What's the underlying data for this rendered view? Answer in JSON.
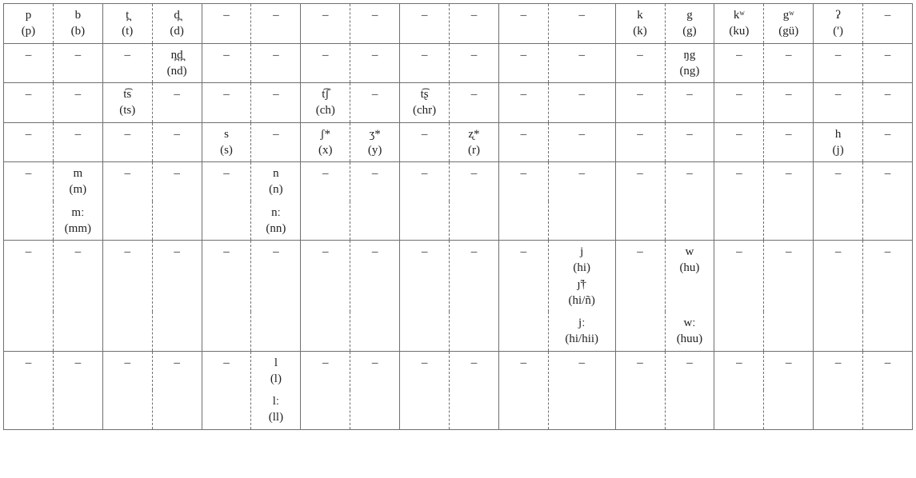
{
  "dash": "–",
  "rows": [
    {
      "cells": [
        {
          "ipa": "p",
          "orth": "(p)"
        },
        {
          "ipa": "b",
          "orth": "(b)"
        },
        {
          "ipa": "t̪",
          "orth": "(t)"
        },
        {
          "ipa": "d̪",
          "orth": "(d)"
        },
        null,
        null,
        null,
        null,
        null,
        null,
        null,
        null,
        {
          "ipa": "k",
          "orth": "(k)"
        },
        {
          "ipa": "g",
          "orth": "(g)"
        },
        {
          "ipa": "kʷ",
          "orth": "(ku)"
        },
        {
          "ipa": "gʷ",
          "orth": "(gü)"
        },
        {
          "ipa": "ʔ",
          "orth": "(')"
        },
        null
      ]
    },
    {
      "cells": [
        null,
        null,
        null,
        {
          "ipa": "n̪d̪",
          "orth": "(nd)"
        },
        null,
        null,
        null,
        null,
        null,
        null,
        null,
        null,
        null,
        {
          "ipa": "ŋg",
          "orth": "(ng)"
        },
        null,
        null,
        null,
        null
      ]
    },
    {
      "cells": [
        null,
        null,
        {
          "ipa": "t͡s",
          "orth": "(ts)"
        },
        null,
        null,
        null,
        {
          "ipa": "t͡ʃ",
          "orth": "(ch)"
        },
        null,
        {
          "ipa": "t͡ʂ",
          "orth": "(chr)"
        },
        null,
        null,
        null,
        null,
        null,
        null,
        null,
        null,
        null
      ]
    },
    {
      "cells": [
        null,
        null,
        null,
        null,
        {
          "ipa": "s",
          "orth": "(s)"
        },
        null,
        {
          "ipa": "ʃ*",
          "orth": "(x)"
        },
        {
          "ipa": "ʒ*",
          "orth": "(y)"
        },
        null,
        {
          "ipa": "ʐ*",
          "orth": "(r)"
        },
        null,
        null,
        null,
        null,
        null,
        null,
        {
          "ipa": "h",
          "orth": "(j)"
        },
        null
      ]
    },
    {
      "cells": [
        null,
        {
          "ipa": "m",
          "orth": "(m)"
        },
        null,
        null,
        null,
        {
          "ipa": "n",
          "orth": "(n)"
        },
        null,
        null,
        null,
        null,
        null,
        null,
        null,
        null,
        null,
        null,
        null,
        null
      ]
    },
    {
      "cells": [
        "",
        {
          "ipa": "mː",
          "orth": "(mm)"
        },
        "",
        "",
        "",
        {
          "ipa": "nː",
          "orth": "(nn)"
        },
        "",
        "",
        "",
        "",
        "",
        "",
        "",
        "",
        "",
        "",
        "",
        ""
      ]
    },
    {
      "cells": [
        null,
        null,
        null,
        null,
        null,
        null,
        null,
        null,
        null,
        null,
        null,
        {
          "ipa": "j",
          "orth": "(hi)",
          "ipa2": "ȷ̃†",
          "orth2": "(hi/ñ)"
        },
        null,
        {
          "ipa": "w",
          "orth": "(hu)"
        },
        null,
        null,
        null,
        null
      ]
    },
    {
      "cells": [
        "",
        "",
        "",
        "",
        "",
        "",
        "",
        "",
        "",
        "",
        "",
        {
          "ipa": "jː",
          "orth": "(hi/hii)"
        },
        "",
        {
          "ipa": "wː",
          "orth": "(huu)"
        },
        "",
        "",
        "",
        ""
      ]
    },
    {
      "cells": [
        null,
        null,
        null,
        null,
        null,
        {
          "ipa": "l",
          "orth": "(l)"
        },
        null,
        null,
        null,
        null,
        null,
        null,
        null,
        null,
        null,
        null,
        null,
        null
      ]
    },
    {
      "cells": [
        "",
        "",
        "",
        "",
        "",
        {
          "ipa": "lː",
          "orth": "(ll)"
        },
        "",
        "",
        "",
        "",
        "",
        "",
        "",
        "",
        "",
        "",
        "",
        ""
      ]
    }
  ]
}
